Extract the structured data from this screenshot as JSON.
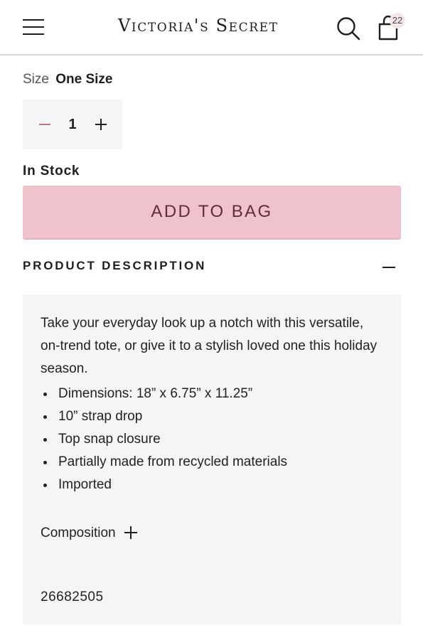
{
  "header": {
    "logo_text": "Victoria's Secret",
    "bag_count": "22",
    "icons": [
      "hamburger-menu-icon",
      "search-icon",
      "shopping-bag-icon"
    ]
  },
  "product": {
    "size_label": "Size",
    "size_value": "One Size",
    "quantity": "1",
    "stock_status": "In Stock",
    "add_to_bag_label": "ADD TO BAG",
    "add_to_bag_color": "#f0c2cb"
  },
  "description": {
    "title": "PRODUCT DESCRIPTION",
    "intro": "Take your everyday look up a notch with this versatile, on-trend tote, or give it to a stylish loved one this holiday season.",
    "bullets": [
      "Dimensions: 18” x 6.75” x 11.25”",
      "10” strap drop",
      "Top snap closure",
      "Partially made from recycled materials",
      "Imported"
    ],
    "composition_label": "Composition",
    "sku": "26682505"
  }
}
